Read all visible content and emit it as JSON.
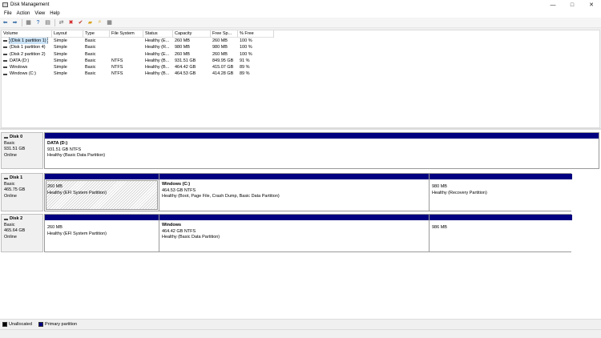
{
  "window": {
    "title": "Disk Management",
    "controls": {
      "minimize": "—",
      "maximize": "□",
      "close": "✕"
    }
  },
  "menu": [
    "File",
    "Action",
    "View",
    "Help"
  ],
  "toolbar": [
    {
      "name": "back-icon",
      "glyph": "⬅",
      "color": "#3a6ea5"
    },
    {
      "name": "forward-icon",
      "glyph": "➡",
      "color": "#3a6ea5"
    },
    {
      "name": "properties-view-icon",
      "glyph": "▦",
      "color": "#555555"
    },
    {
      "name": "help-icon",
      "glyph": "?",
      "color": "#1e5fb4"
    },
    {
      "name": "list-view-icon",
      "glyph": "▤",
      "color": "#555555"
    },
    {
      "name": "connect-icon",
      "glyph": "⇄",
      "color": "#555555"
    },
    {
      "name": "delete-icon",
      "glyph": "✖",
      "color": "#d42020"
    },
    {
      "name": "check-icon",
      "glyph": "✔",
      "color": "#c0392b"
    },
    {
      "name": "folder-icon",
      "glyph": "▰",
      "color": "#d9a520"
    },
    {
      "name": "search-icon",
      "glyph": "⌕",
      "color": "#d9a520"
    },
    {
      "name": "grid-icon",
      "glyph": "▦",
      "color": "#555555"
    }
  ],
  "volume_list": {
    "columns": [
      "Volume",
      "Layout",
      "Type",
      "File System",
      "Status",
      "Capacity",
      "Free Sp...",
      "% Free"
    ],
    "rows": [
      {
        "volume": "(Disk 1 partition 1)",
        "layout": "Simple",
        "type": "Basic",
        "fs": "",
        "status": "Healthy (E...",
        "capacity": "260 MB",
        "free": "260 MB",
        "pct": "100 %",
        "selected": true
      },
      {
        "volume": "(Disk 1 partition 4)",
        "layout": "Simple",
        "type": "Basic",
        "fs": "",
        "status": "Healthy (R...",
        "capacity": "980 MB",
        "free": "980 MB",
        "pct": "100 %"
      },
      {
        "volume": "(Disk 2 partition 2)",
        "layout": "Simple",
        "type": "Basic",
        "fs": "",
        "status": "Healthy (E...",
        "capacity": "260 MB",
        "free": "260 MB",
        "pct": "100 %"
      },
      {
        "volume": "DATA (D:)",
        "layout": "Simple",
        "type": "Basic",
        "fs": "NTFS",
        "status": "Healthy (B...",
        "capacity": "931.51 GB",
        "free": "849.95 GB",
        "pct": "91 %"
      },
      {
        "volume": "Windows",
        "layout": "Simple",
        "type": "Basic",
        "fs": "NTFS",
        "status": "Healthy (B...",
        "capacity": "464.42 GB",
        "free": "415.07 GB",
        "pct": "89 %"
      },
      {
        "volume": "Windows (C:)",
        "layout": "Simple",
        "type": "Basic",
        "fs": "NTFS",
        "status": "Healthy (B...",
        "capacity": "464.53 GB",
        "free": "414.28 GB",
        "pct": "89 %"
      }
    ]
  },
  "disks": [
    {
      "name": "Disk 0",
      "type": "Basic",
      "size": "931.51 GB",
      "status": "Online",
      "partitions": [
        {
          "name": "DATA  (D:)",
          "size_fs": "931.51 GB NTFS",
          "status": "Healthy (Basic Data Partition)"
        }
      ]
    },
    {
      "name": "Disk 1",
      "type": "Basic",
      "size": "465.75 GB",
      "status": "Online",
      "partitions": [
        {
          "name": "",
          "size_fs": "260 MB",
          "status": "Healthy (EFI System Partition)",
          "selected": true
        },
        {
          "name": "Windows  (C:)",
          "size_fs": "464.53 GB NTFS",
          "status": "Healthy (Boot, Page File, Crash Dump, Basic Data Partition)"
        },
        {
          "name": "",
          "size_fs": "980 MB",
          "status": "Healthy (Recovery Partition)"
        }
      ]
    },
    {
      "name": "Disk 2",
      "type": "Basic",
      "size": "465.64 GB",
      "status": "Online",
      "partitions": [
        {
          "name": "",
          "size_fs": "260 MB",
          "status": "Healthy (EFI System Partition)"
        },
        {
          "name": "Windows",
          "size_fs": "464.42 GB NTFS",
          "status": "Healthy (Basic Data Partition)"
        },
        {
          "name": "",
          "size_fs": "986 MB",
          "status": ""
        }
      ]
    }
  ],
  "legend": [
    {
      "label": "Unallocated",
      "color": "#000000"
    },
    {
      "label": "Primary partition",
      "color": "#000080"
    }
  ]
}
